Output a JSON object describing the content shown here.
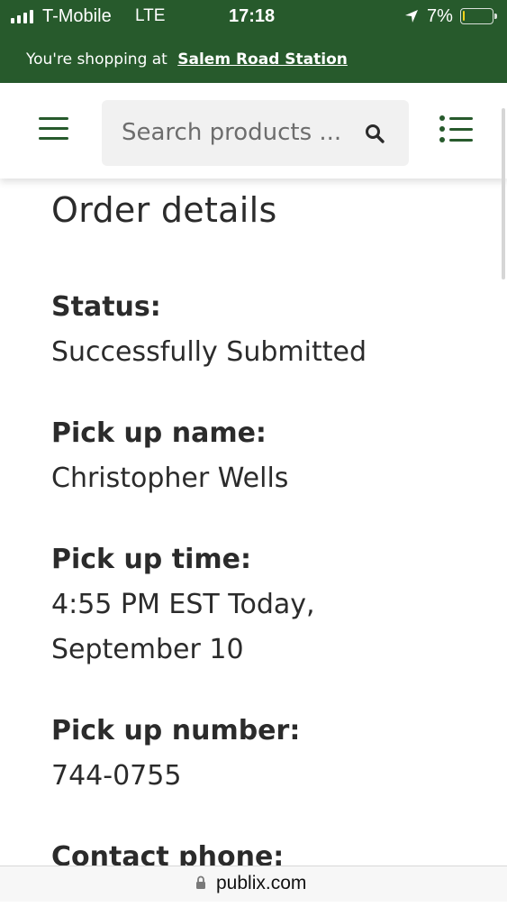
{
  "status_bar": {
    "carrier": "T-Mobile",
    "network": "LTE",
    "time": "17:18",
    "battery_percent": "7%",
    "battery_level": 0.07,
    "battery_color": "#f2d31b"
  },
  "store_banner": {
    "prefix": "You're shopping at",
    "store_name": "Salem Road Station"
  },
  "header": {
    "menu_icon": "hamburger-menu-icon",
    "search_placeholder": "Search products ...",
    "search_icon": "search-icon",
    "list_icon": "shopping-list-icon"
  },
  "order": {
    "title": "Order details",
    "fields": [
      {
        "label": "Status:",
        "value": "Successfully Submitted"
      },
      {
        "label": "Pick up name:",
        "value": "Christopher Wells"
      },
      {
        "label": "Pick up time:",
        "value_line1": "4:55 PM EST Today,",
        "value_line2": "September 10"
      },
      {
        "label": "Pick up number:",
        "value": "744-0755"
      },
      {
        "label": "Contact phone:"
      }
    ]
  },
  "browser": {
    "url": "publix.com",
    "lock_icon": "lock-icon"
  },
  "colors": {
    "brand_green": "#275a2c",
    "text": "#2b2b2b",
    "search_bg": "#f1f1f1"
  }
}
